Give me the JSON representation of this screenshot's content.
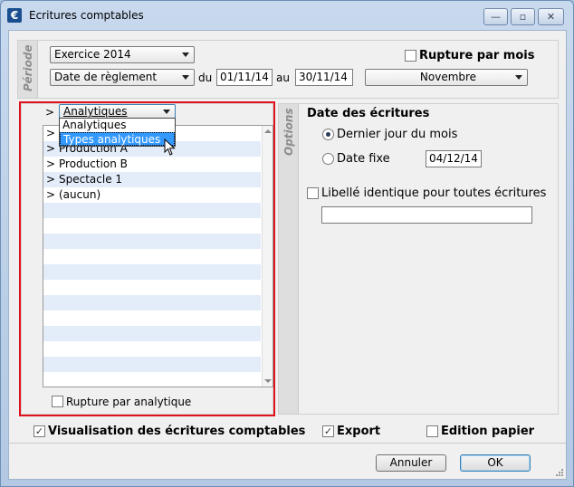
{
  "window": {
    "title": "Ecritures comptables",
    "icon_glyph": "€",
    "min_glyph": "—",
    "max_glyph": "▫",
    "close_glyph": "✕"
  },
  "periode": {
    "tab_label": "Période",
    "exercice": "Exercice 2014",
    "date_type": "Date de règlement",
    "du_label": "du",
    "du_value": "01/11/14",
    "au_label": "au",
    "au_value": "30/11/14",
    "month": "Novembre",
    "rupture_mois_label": "Rupture par mois",
    "rupture_mois_checked": false
  },
  "analytics": {
    "dropdown_value": "Analytiques",
    "dropdown_options": [
      "Analytiques",
      "Types analytiques"
    ],
    "list_rows": [
      {
        "mark": ">",
        "text": ""
      },
      {
        "mark": ">",
        "text": "Production A"
      },
      {
        "mark": ">",
        "text": "Production B"
      },
      {
        "mark": ">",
        "text": "Spectacle 1"
      },
      {
        "mark": ">",
        "text": "(aucun)"
      }
    ],
    "rupture_analytique_label": "Rupture par analytique",
    "rupture_analytique_checked": false
  },
  "options": {
    "tab_label": "Options",
    "date_header": "Date des écritures",
    "radio_last_day": "Dernier jour du mois",
    "radio_fixed": "Date fixe",
    "fixed_date_value": "04/12/14",
    "selected": "last_day",
    "libelle_label": "Libellé identique pour toutes écritures",
    "libelle_checked": false,
    "libelle_value": ""
  },
  "footer": {
    "visualisation_label": "Visualisation des écritures comptables",
    "visualisation_checked": true,
    "export_label": "Export",
    "export_checked": true,
    "edition_label": "Edition papier",
    "edition_checked": false,
    "cancel_label": "Annuler",
    "ok_label": "OK"
  },
  "check_glyph": "✓",
  "colors": {
    "highlight_frame": "#e0101c",
    "selection": "#3399ff",
    "stripe": "#e3ecf9"
  }
}
